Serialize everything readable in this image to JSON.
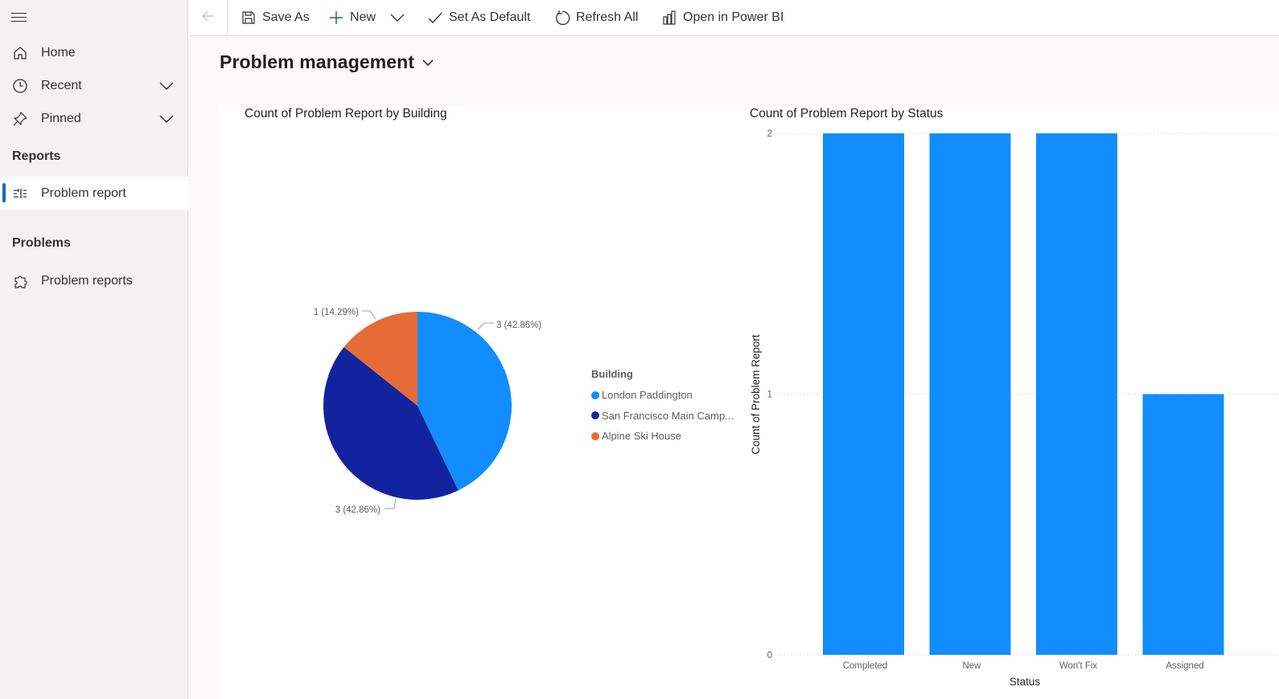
{
  "sidebar": {
    "items": [
      {
        "label": "Home",
        "icon": "home-icon"
      },
      {
        "label": "Recent",
        "icon": "clock-icon"
      },
      {
        "label": "Pinned",
        "icon": "pin-icon"
      }
    ],
    "sections": [
      {
        "title": "Reports",
        "items": [
          {
            "label": "Problem report",
            "icon": "report-icon",
            "active": true
          }
        ]
      },
      {
        "title": "Problems",
        "items": [
          {
            "label": "Problem reports",
            "icon": "puzzle-icon"
          }
        ]
      }
    ]
  },
  "toolbar": {
    "save_as": "Save As",
    "new": "New",
    "set_default": "Set As Default",
    "refresh_all": "Refresh All",
    "open_powerbi": "Open in Power BI"
  },
  "page": {
    "title": "Problem management"
  },
  "colors": {
    "accent": "#0f6cbd",
    "london": "#118dff",
    "sanfrancisco": "#12239e",
    "alpine": "#e66c37",
    "bar": "#118dff"
  },
  "chart_data": [
    {
      "type": "pie",
      "title": "Count of Problem Report by Building",
      "legend_title": "Building",
      "legend_position": "right",
      "slices": [
        {
          "name": "London Paddington",
          "legend_label": "London Paddington",
          "value": 3,
          "label": "3 (42.86%)",
          "color": "#118dff"
        },
        {
          "name": "San Francisco Main Campus",
          "legend_label": "San Francisco Main Camp...",
          "value": 3,
          "label": "3 (42.86%)",
          "color": "#12239e"
        },
        {
          "name": "Alpine Ski House",
          "legend_label": "Alpine Ski House",
          "value": 1,
          "label": "1 (14.29%)",
          "color": "#e66c37"
        }
      ]
    },
    {
      "type": "bar",
      "title": "Count of Problem Report by Status",
      "categories": [
        "Completed",
        "New",
        "Won't Fix",
        "Assigned"
      ],
      "values": [
        2,
        2,
        2,
        1
      ],
      "xlabel": "Status",
      "ylabel": "Count of Problem Report",
      "ylim": [
        0,
        2
      ],
      "yticks": [
        "0",
        "1",
        "2"
      ],
      "grid": true
    }
  ]
}
